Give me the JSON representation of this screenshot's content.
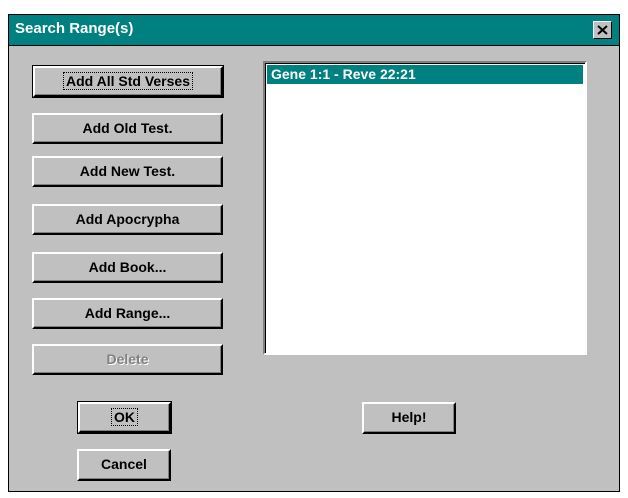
{
  "dialog": {
    "title": "Search Range(s)"
  },
  "buttons": {
    "add_all_std_verses": "Add All Std Verses",
    "add_old_test": "Add Old Test.",
    "add_new_test": "Add New Test.",
    "add_apocrypha": "Add Apocrypha",
    "add_book": "Add Book...",
    "add_range": "Add Range...",
    "delete": "Delete",
    "ok": "OK",
    "cancel": "Cancel",
    "help": "Help!"
  },
  "ranges": {
    "items": [
      {
        "label": "Gene 1:1 - Reve 22:21",
        "selected": true
      }
    ]
  },
  "colors": {
    "title_bar": "#008080",
    "selection": "#008080",
    "dialog_face": "#c0c0c0"
  }
}
